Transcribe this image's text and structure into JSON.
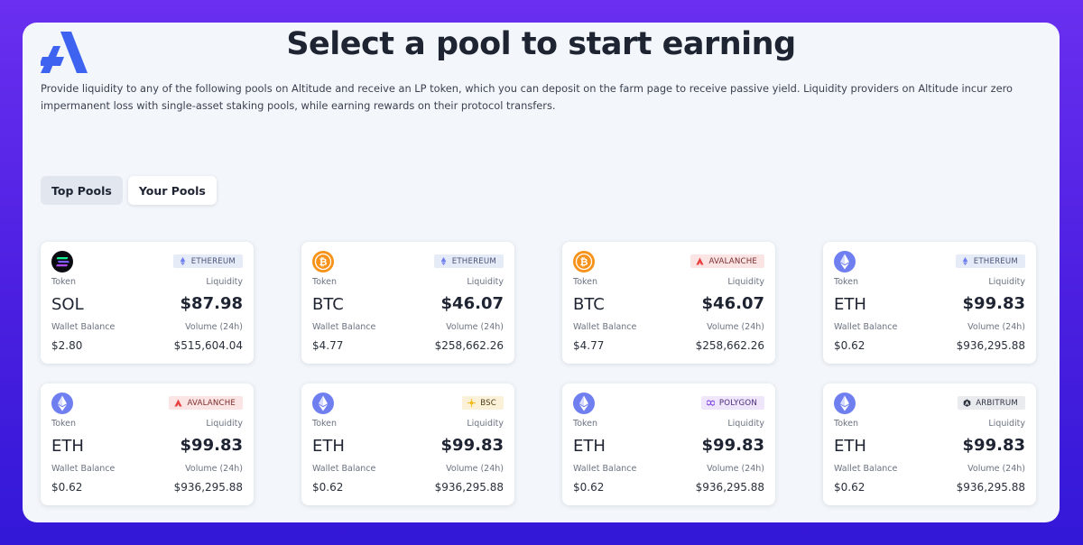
{
  "title": "Select a pool to start earning",
  "description": "Provide liquidity to any of the following pools on Altitude and receive an LP token, which you can deposit on the farm page to receive passive yield. Liquidity providers on Altitude incur zero impermanent loss with single-asset staking pools, while earning rewards on their protocol transfers.",
  "tabs": [
    {
      "label": "Top Pools",
      "active": true
    },
    {
      "label": "Your Pools",
      "active": false
    }
  ],
  "labels": {
    "token": "Token",
    "liquidity": "Liquidity",
    "wallet_balance": "Wallet Balance",
    "volume": "Volume (24h)"
  },
  "pools": [
    {
      "token": "SOL",
      "token_icon": "solana-icon",
      "chain": "ETHEREUM",
      "chain_icon": "ethereum-icon",
      "liquidity": "$87.98",
      "wallet_balance": "$2.80",
      "volume": "$515,604.04"
    },
    {
      "token": "BTC",
      "token_icon": "bitcoin-icon",
      "chain": "ETHEREUM",
      "chain_icon": "ethereum-icon",
      "liquidity": "$46.07",
      "wallet_balance": "$4.77",
      "volume": "$258,662.26"
    },
    {
      "token": "BTC",
      "token_icon": "bitcoin-icon",
      "chain": "AVALANCHE",
      "chain_icon": "avalanche-icon",
      "liquidity": "$46.07",
      "wallet_balance": "$4.77",
      "volume": "$258,662.26"
    },
    {
      "token": "ETH",
      "token_icon": "ethereum-icon",
      "chain": "ETHEREUM",
      "chain_icon": "ethereum-icon",
      "liquidity": "$99.83",
      "wallet_balance": "$0.62",
      "volume": "$936,295.88"
    },
    {
      "token": "ETH",
      "token_icon": "ethereum-icon",
      "chain": "AVALANCHE",
      "chain_icon": "avalanche-icon",
      "liquidity": "$99.83",
      "wallet_balance": "$0.62",
      "volume": "$936,295.88"
    },
    {
      "token": "ETH",
      "token_icon": "ethereum-icon",
      "chain": "BSC",
      "chain_icon": "bnb-icon",
      "liquidity": "$99.83",
      "wallet_balance": "$0.62",
      "volume": "$936,295.88"
    },
    {
      "token": "ETH",
      "token_icon": "ethereum-icon",
      "chain": "POLYGON",
      "chain_icon": "polygon-icon",
      "liquidity": "$99.83",
      "wallet_balance": "$0.62",
      "volume": "$936,295.88"
    },
    {
      "token": "ETH",
      "token_icon": "ethereum-icon",
      "chain": "ARBITRUM",
      "chain_icon": "arbitrum-icon",
      "liquidity": "$99.83",
      "wallet_balance": "$0.62",
      "volume": "$936,295.88"
    }
  ],
  "colors": {
    "ETHEREUM": {
      "bg": "#e6ebf8",
      "fg": "#4a5478"
    },
    "AVALANCHE": {
      "bg": "#fbe4e4",
      "fg": "#7a2a2a"
    },
    "BSC": {
      "bg": "#fbf1d8",
      "fg": "#4a3b12"
    },
    "POLYGON": {
      "bg": "#efe6fb",
      "fg": "#4a2c78"
    },
    "ARBITRUM": {
      "bg": "#e9ebef",
      "fg": "#2d3240"
    },
    "accent": "#4f6bff",
    "background": "#5a27ea"
  }
}
